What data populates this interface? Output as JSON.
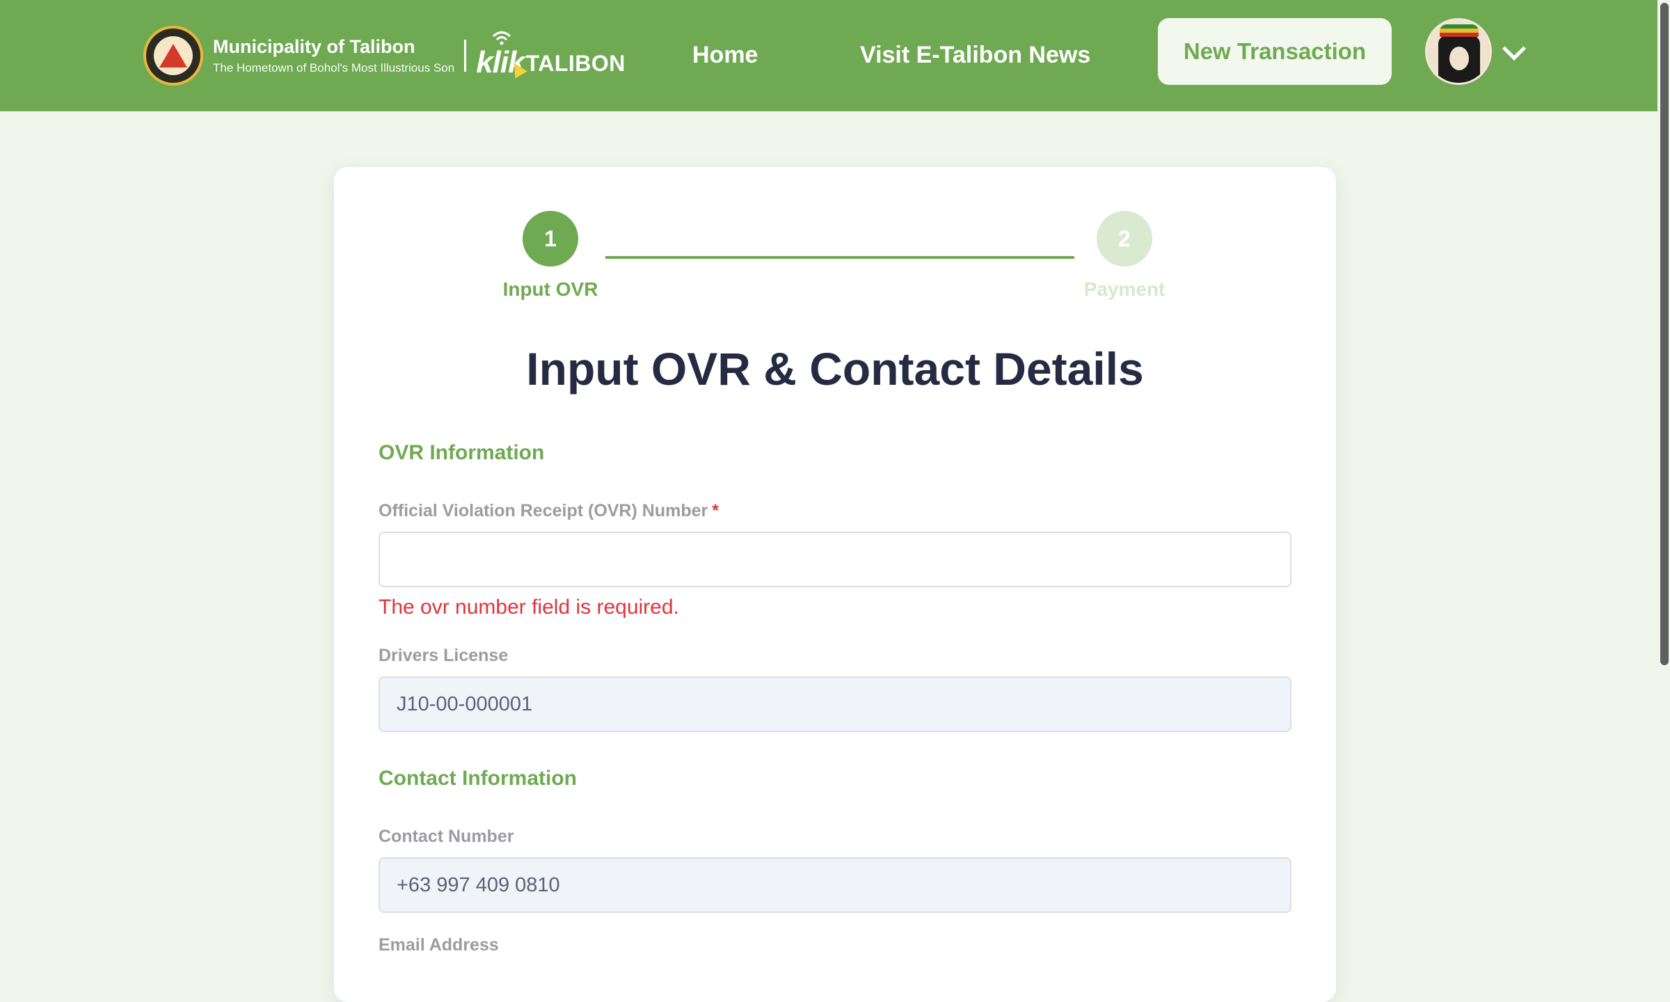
{
  "header": {
    "brand_title": "Municipality of Talibon",
    "brand_subtitle": "The Hometown of Bohol's Most Illustrious Son",
    "app_logo_prefix": "klik",
    "app_logo_suffix": "TALIBON",
    "nav": {
      "home": "Home",
      "news": "Visit E-Talibon News"
    },
    "new_transaction": "New Transaction"
  },
  "stepper": {
    "steps": [
      {
        "number": "1",
        "label": "Input OVR",
        "state": "active"
      },
      {
        "number": "2",
        "label": "Payment",
        "state": "pending"
      }
    ]
  },
  "form": {
    "title": "Input OVR & Contact Details",
    "ovr_section": "OVR Information",
    "ovr_label": "Official Violation Receipt (OVR) Number",
    "required_mark": "*",
    "ovr_value": "",
    "ovr_error": "The ovr number field is required.",
    "dl_label": "Drivers License",
    "dl_value": "J10-00-000001",
    "contact_section": "Contact Information",
    "contact_label": "Contact Number",
    "contact_value": "+63 997 409 0810",
    "email_label": "Email Address"
  },
  "colors": {
    "brand_green": "#6faa52",
    "page_bg": "#f0f6ec",
    "error_red": "#e0333a",
    "title_navy": "#252b42"
  },
  "icons": {
    "seal": "municipal-seal-icon",
    "avatar": "user-avatar",
    "dropdown": "chevron-down-icon"
  }
}
